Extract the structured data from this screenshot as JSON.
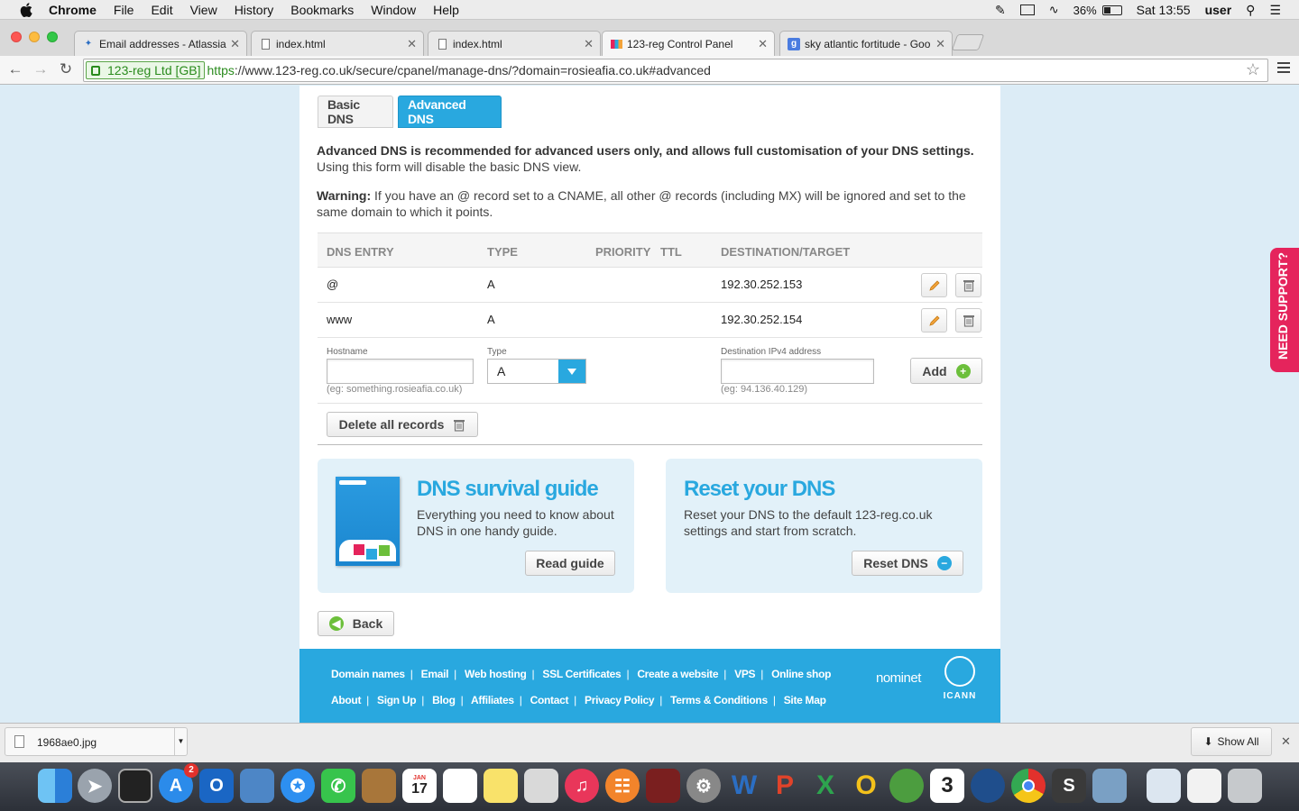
{
  "menubar": {
    "app": "Chrome",
    "items": [
      "File",
      "Edit",
      "View",
      "History",
      "Bookmarks",
      "Window",
      "Help"
    ],
    "battery": "36%",
    "clock": "Sat 13:55",
    "user": "user"
  },
  "tabs": [
    {
      "title": "Email addresses - Atlassia",
      "fav": "atlassian-icon"
    },
    {
      "title": "index.html",
      "fav": "page-icon"
    },
    {
      "title": "index.html",
      "fav": "page-icon"
    },
    {
      "title": "123-reg Control Panel",
      "fav": "123reg-icon"
    },
    {
      "title": "sky atlantic fortitude - Goo",
      "fav": "google-icon"
    }
  ],
  "address": {
    "ev_label": "123-reg Ltd [GB]",
    "scheme": "https",
    "rest": "://www.123-reg.co.uk/secure/cpanel/manage-dns/?domain=rosieafia.co.uk#advanced"
  },
  "dns_tabs": {
    "basic": "Basic DNS",
    "advanced": "Advanced DNS"
  },
  "intro": {
    "bold": "Advanced DNS is recommended for advanced users only, and allows full customisation of your DNS settings.",
    "normal": "Using this form will disable the basic DNS view."
  },
  "warning": {
    "label": "Warning:",
    "text": " If you have an @ record set to a CNAME, all other @ records (including MX) will be ignored and set to the same domain to which it points."
  },
  "table": {
    "headers": [
      "DNS ENTRY",
      "TYPE",
      "PRIORITY",
      "TTL",
      "DESTINATION/TARGET"
    ],
    "rows": [
      {
        "entry": "@",
        "type": "A",
        "priority": "",
        "ttl": "",
        "dest": "192.30.252.153"
      },
      {
        "entry": "www",
        "type": "A",
        "priority": "",
        "ttl": "",
        "dest": "192.30.252.154"
      }
    ]
  },
  "add_form": {
    "hostname_label": "Hostname",
    "hostname_hint": "(eg: something.rosieafia.co.uk)",
    "type_label": "Type",
    "type_value": "A",
    "dest_label": "Destination IPv4 address",
    "dest_hint": "(eg: 94.136.40.129)",
    "add_button": "Add",
    "delete_all": "Delete all records"
  },
  "cards": {
    "guide_title": "DNS survival guide",
    "guide_text": "Everything you need to know about DNS in one handy guide.",
    "guide_button": "Read guide",
    "reset_title": "Reset your DNS",
    "reset_text": "Reset your DNS to the default 123-reg.co.uk settings and start from scratch.",
    "reset_button": "Reset DNS"
  },
  "back_button": "Back",
  "footer": {
    "row1": [
      "Domain names",
      "Email",
      "Web hosting",
      "SSL Certificates",
      "Create a website",
      "VPS",
      "Online shop"
    ],
    "row2": [
      "About",
      "Sign Up",
      "Blog",
      "Affiliates",
      "Contact",
      "Privacy Policy",
      "Terms & Conditions",
      "Site Map"
    ],
    "nominet": "nominet",
    "icann": "ICANN"
  },
  "support_tab": "NEED SUPPORT?",
  "download": {
    "file": "1968ae0.jpg",
    "show_all": "Show All"
  },
  "dock": {
    "badge": "2",
    "calendar_month": "JAN",
    "calendar_day": "17"
  },
  "colors": {
    "accent": "#29a8df",
    "support": "#e5245c",
    "ev_green": "#2a8b1d"
  }
}
